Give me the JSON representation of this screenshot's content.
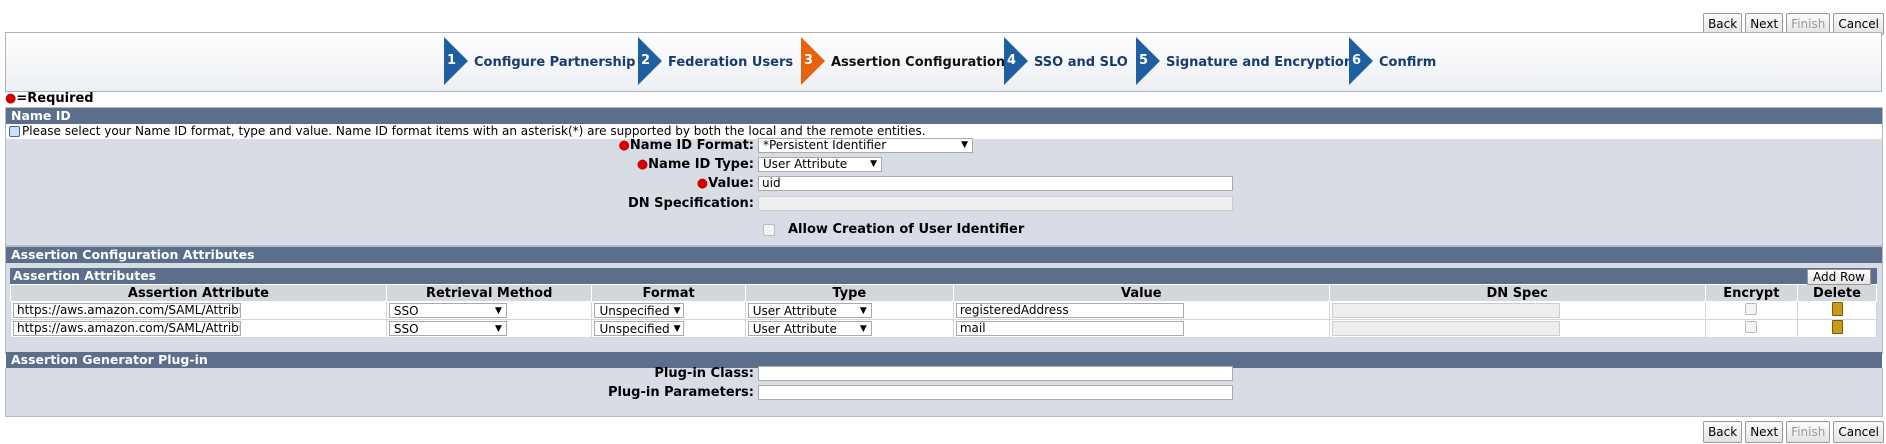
{
  "nav": {
    "back": "Back",
    "next": "Next",
    "finish": "Finish",
    "cancel": "Cancel"
  },
  "wizard": {
    "steps": [
      {
        "num": "1",
        "label": "Configure Partnership"
      },
      {
        "num": "2",
        "label": "Federation Users"
      },
      {
        "num": "3",
        "label": "Assertion Configuration"
      },
      {
        "num": "4",
        "label": "SSO and SLO"
      },
      {
        "num": "5",
        "label": "Signature and Encryption"
      },
      {
        "num": "6",
        "label": "Confirm"
      }
    ],
    "active_index": 3,
    "colors": {
      "inactive": "#1f5fa0",
      "active": "#e8620e"
    }
  },
  "required_legend": "=Required",
  "name_id": {
    "title": "Name ID",
    "info": "Please select your Name ID format, type and value. Name ID format items with an asterisk(*) are supported by both the local and the remote entities.",
    "format_label": "Name ID Format:",
    "format_value": "*Persistent Identifier",
    "type_label": "Name ID Type:",
    "type_value": "User Attribute",
    "value_label": "Value:",
    "value_value": "uid",
    "dn_label": "DN Specification:",
    "dn_value": "",
    "allow_creation_label": "Allow Creation of User Identifier",
    "allow_creation_checked": false
  },
  "assertion_config": {
    "title": "Assertion Configuration Attributes",
    "sub_title": "Assertion Attributes",
    "add_row": "Add Row",
    "columns": [
      "Assertion Attribute",
      "Retrieval Method",
      "Format",
      "Type",
      "Value",
      "DN Spec",
      "Encrypt",
      "Delete"
    ],
    "rows": [
      {
        "attribute": "https://aws.amazon.com/SAML/Attribu",
        "retrieval": "SSO",
        "format": "Unspecified",
        "type": "User Attribute",
        "value": "registeredAddress",
        "dn_spec": ""
      },
      {
        "attribute": "https://aws.amazon.com/SAML/Attribu",
        "retrieval": "SSO",
        "format": "Unspecified",
        "type": "User Attribute",
        "value": "mail",
        "dn_spec": ""
      }
    ]
  },
  "plugin": {
    "title": "Assertion Generator Plug-in",
    "class_label": "Plug-in Class:",
    "class_value": "",
    "params_label": "Plug-in Parameters:",
    "params_value": ""
  },
  "icons": {
    "info": "info-search-icon",
    "delete": "trash-icon",
    "required": "red-dot-icon"
  }
}
